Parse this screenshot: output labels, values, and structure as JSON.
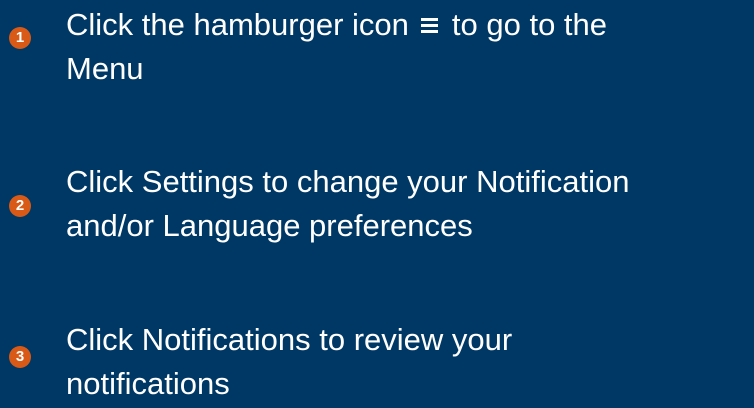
{
  "steps": [
    {
      "number": "1",
      "text_before_icon": "Click the hamburger icon",
      "icon": "hamburger-icon",
      "text_after_icon": "to go to the",
      "line2": "Menu"
    },
    {
      "number": "2",
      "line1": "Click Settings to change your Notification",
      "line2": "and/or Language preferences"
    },
    {
      "number": "3",
      "line1": "Click Notifications to review your",
      "line2": "notifications"
    }
  ],
  "colors": {
    "background": "#003865",
    "badge": "#d85a16",
    "text": "#ffffff"
  }
}
